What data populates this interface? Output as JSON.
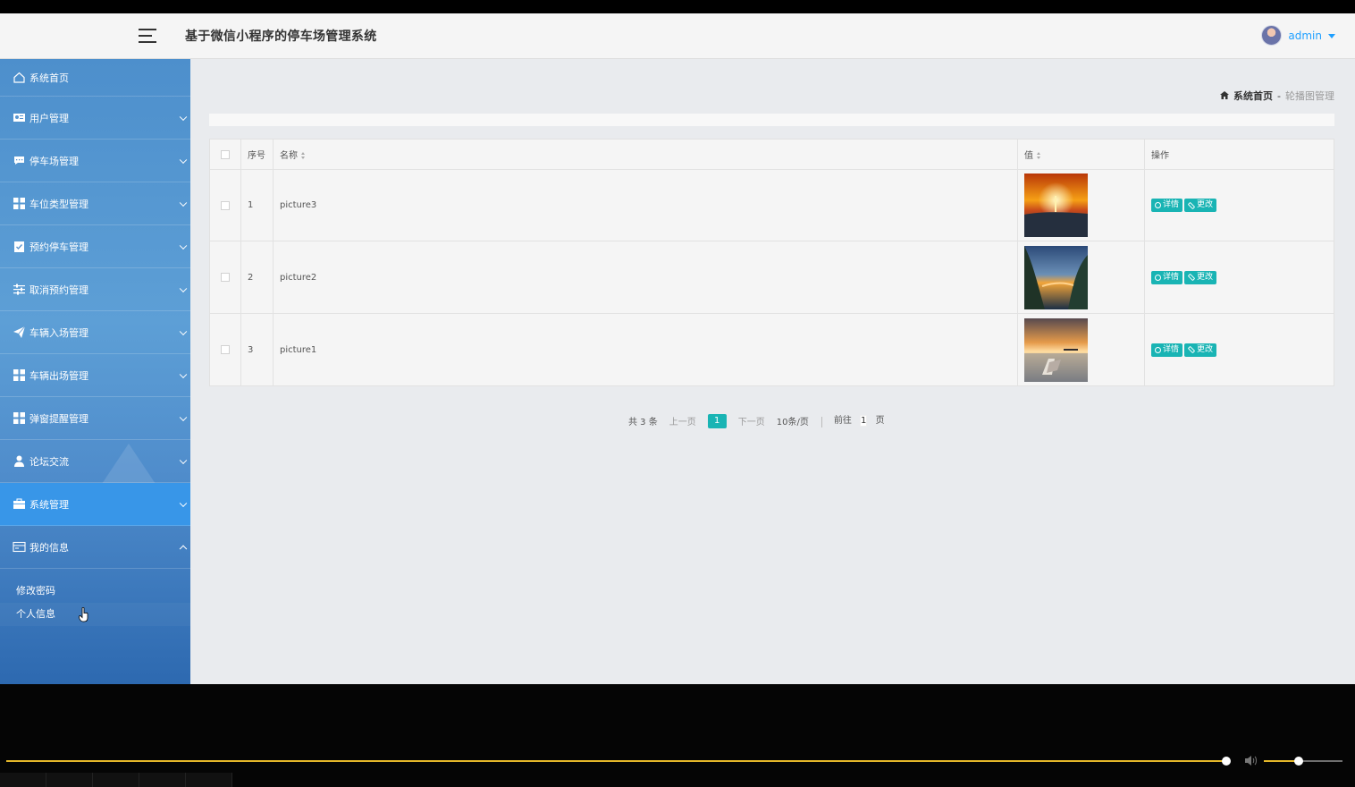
{
  "header": {
    "app_title": "基于微信小程序的停车场管理系统",
    "username": "admin"
  },
  "sidebar": {
    "items": [
      {
        "label": "系统首页",
        "icon": "home-icon"
      },
      {
        "label": "用户管理",
        "icon": "user-management-icon"
      },
      {
        "label": "停车场管理",
        "icon": "message-icon"
      },
      {
        "label": "车位类型管理",
        "icon": "grid-icon"
      },
      {
        "label": "预约停车管理",
        "icon": "calendar-check-icon"
      },
      {
        "label": "取消预约管理",
        "icon": "sliders-icon"
      },
      {
        "label": "车辆入场管理",
        "icon": "paper-plane-icon"
      },
      {
        "label": "车辆出场管理",
        "icon": "grid-icon"
      },
      {
        "label": "弹窗提醒管理",
        "icon": "grid-icon"
      },
      {
        "label": "论坛交流",
        "icon": "person-icon"
      },
      {
        "label": "系统管理",
        "icon": "briefcase-icon"
      },
      {
        "label": "我的信息",
        "icon": "id-card-icon"
      }
    ],
    "submenu": [
      {
        "label": "修改密码"
      },
      {
        "label": "个人信息"
      }
    ]
  },
  "breadcrumb": {
    "home": "系统首页",
    "separator": "-",
    "current": "轮播图管理"
  },
  "table": {
    "headers": {
      "index": "序号",
      "name": "名称",
      "value": "值",
      "actions": "操作"
    },
    "rows": [
      {
        "index": "1",
        "name": "picture3",
        "image": "sunset-sea-orange"
      },
      {
        "index": "2",
        "name": "picture2",
        "image": "cliff-sunset-blue"
      },
      {
        "index": "3",
        "name": "picture1",
        "image": "beach-chair-sunset"
      }
    ],
    "action_labels": {
      "detail": "详情",
      "edit": "更改"
    }
  },
  "pagination": {
    "total": "共 3 条",
    "prev": "上一页",
    "current_page": "1",
    "next": "下一页",
    "page_size": "10条/页",
    "goto_prefix": "前往",
    "goto_value": "1",
    "goto_suffix": "页"
  },
  "player": {
    "progress_fraction": 0.9,
    "volume_fraction": 0.44
  },
  "colors": {
    "accent": "#1e9fff",
    "button": "#19b4b4",
    "sidebar_active": "#3896e8"
  }
}
